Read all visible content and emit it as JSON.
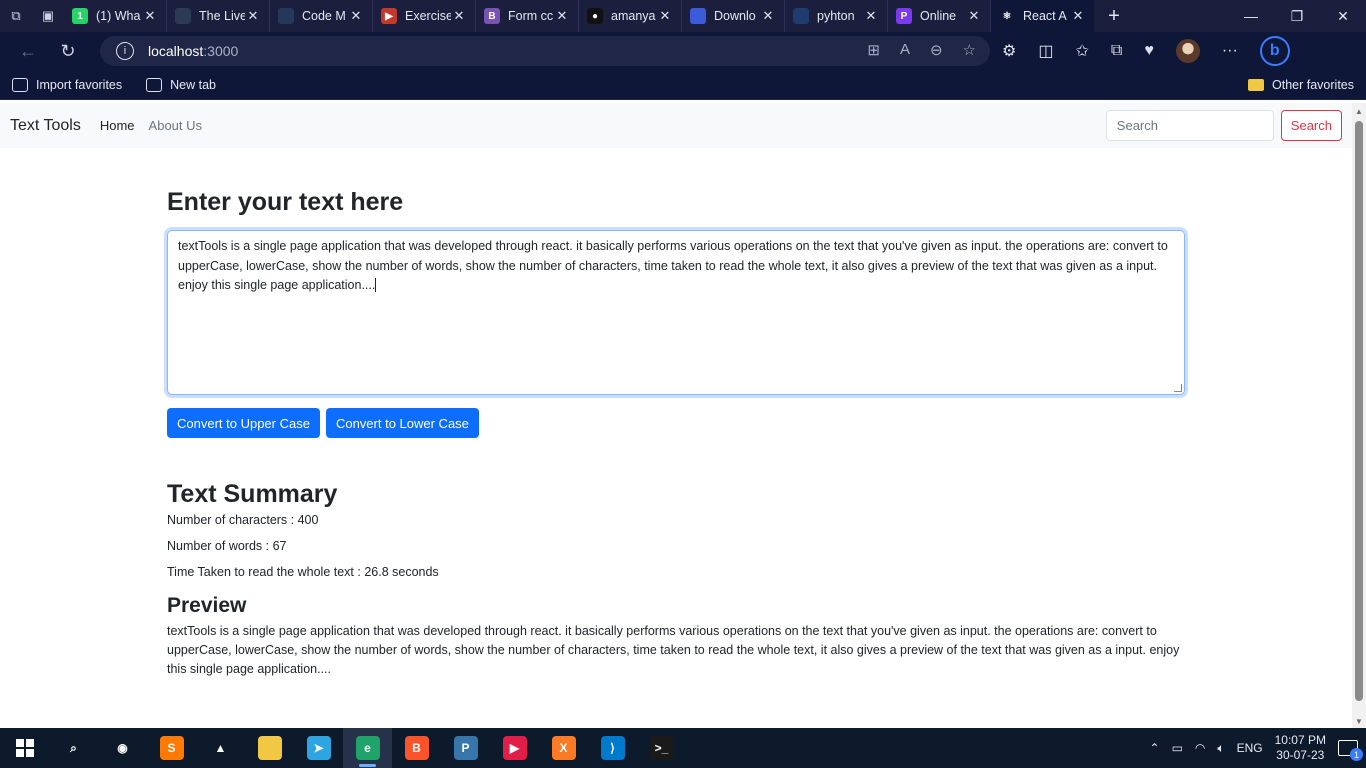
{
  "browser": {
    "tabs": [
      {
        "title": "(1) Wha",
        "favicon_color": "#25d366",
        "favicon_char": "1"
      },
      {
        "title": "The Live",
        "favicon_color": "#2c3a55",
        "favicon_char": ""
      },
      {
        "title": "Code M",
        "favicon_color": "#23385a",
        "favicon_char": ""
      },
      {
        "title": "Exercise",
        "favicon_color": "#c0392b",
        "favicon_char": "▶"
      },
      {
        "title": "Form cc",
        "favicon_color": "#7952b3",
        "favicon_char": "B"
      },
      {
        "title": "amanya",
        "favicon_color": "#111111",
        "favicon_char": "●"
      },
      {
        "title": "Downlo",
        "favicon_color": "#3b5bdb",
        "favicon_char": ""
      },
      {
        "title": "pyhton",
        "favicon_color": "#1e3d6e",
        "favicon_char": ""
      },
      {
        "title": "Online",
        "favicon_color": "#7c3aed",
        "favicon_char": "P"
      },
      {
        "title": "React A",
        "favicon_color": "#0f1738",
        "favicon_char": "⚛",
        "active": true
      }
    ],
    "address": {
      "host": "localhost",
      "port": ":3000"
    },
    "favorites": {
      "import_label": "Import favorites",
      "newtab_label": "New tab",
      "other_label": "Other favorites"
    }
  },
  "navbar": {
    "brand": "Text Tools",
    "links": {
      "home": "Home",
      "about": "About Us"
    },
    "search_placeholder": "Search",
    "search_button": "Search"
  },
  "form": {
    "heading": "Enter your text here",
    "textarea_value": "textTools is a single page application that was developed through react. it basically performs various operations on the text that you've given as input. the operations are: convert to upperCase, lowerCase, show the number of words, show the number of characters, time taken to read the whole text, it also gives a preview of the text that was given as a input. enjoy this single page application....",
    "upper_button": "Convert to Upper Case",
    "lower_button": "Convert to Lower Case"
  },
  "summary": {
    "heading": "Text Summary",
    "characters": "Number of characters : 400",
    "words": "Number of words : 67",
    "time": "Time Taken to read the whole text : 26.8 seconds"
  },
  "preview": {
    "heading": "Preview",
    "text": "textTools is a single page application that was developed through react. it basically performs various operations on the text that you've given as input. the operations are: convert to upperCase, lowerCase, show the number of words, show the number of characters, time taken to read the whole text, it also gives a preview of the text that was given as a input. enjoy this single page application...."
  },
  "taskbar": {
    "apps": [
      {
        "name": "search-icon",
        "color": "#0d1a2b",
        "char": "⌕"
      },
      {
        "name": "obs-icon",
        "color": "#0d1a2b",
        "char": "◉"
      },
      {
        "name": "sublime-icon",
        "color": "#ff7a00",
        "char": "S"
      },
      {
        "name": "vlc-icon",
        "color": "#0d1a2b",
        "char": "▲"
      },
      {
        "name": "file-explorer-icon",
        "color": "#f2c744",
        "char": ""
      },
      {
        "name": "telegram-icon",
        "color": "#2ca5e0",
        "char": "➤"
      },
      {
        "name": "edge-icon",
        "color": "#1fa36b",
        "char": "e",
        "active": true
      },
      {
        "name": "brave-icon",
        "color": "#fb542b",
        "char": "B"
      },
      {
        "name": "python-icon",
        "color": "#3776ab",
        "char": "P"
      },
      {
        "name": "streaming-app-icon",
        "color": "#e11d48",
        "char": "▶"
      },
      {
        "name": "xampp-icon",
        "color": "#fb7a24",
        "char": "X"
      },
      {
        "name": "vscode-icon",
        "color": "#007acc",
        "char": "⟩"
      },
      {
        "name": "terminal-icon",
        "color": "#1a1a1a",
        "char": ">_"
      }
    ],
    "language": "ENG",
    "time": "10:07 PM",
    "date": "30-07-23",
    "notification_count": "1"
  }
}
